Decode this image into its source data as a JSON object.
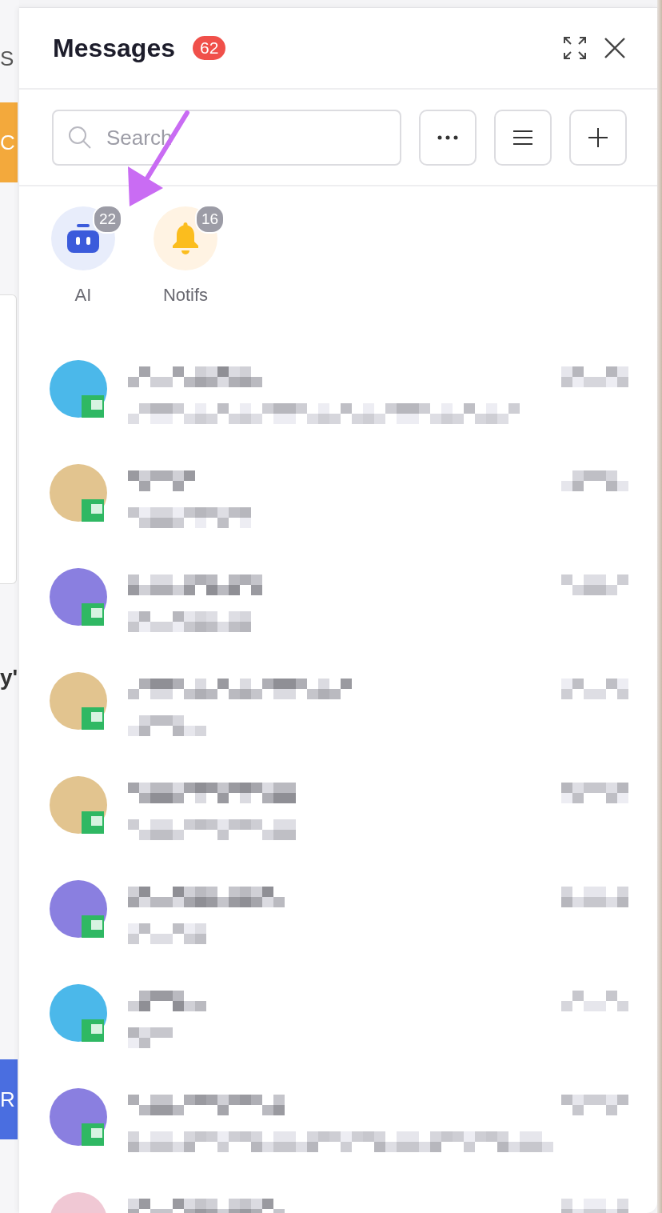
{
  "background_app": {
    "items": [
      {
        "kind": "text",
        "text": "S"
      },
      {
        "kind": "button",
        "text": "C",
        "color": "#f3a93c"
      },
      {
        "kind": "card"
      },
      {
        "kind": "heading",
        "text": "y'"
      },
      {
        "kind": "button",
        "text": "R",
        "color": "#4a6ee0"
      }
    ]
  },
  "panel": {
    "title": "Messages",
    "unread_count": "62",
    "search": {
      "placeholder": "Search"
    },
    "toolbar_buttons": [
      {
        "kind": "more"
      },
      {
        "kind": "filter"
      },
      {
        "kind": "add"
      }
    ],
    "shortcuts": [
      {
        "kind": "ai",
        "label": "AI",
        "count": "22"
      },
      {
        "kind": "notifications",
        "label": "Notifs",
        "count": "16"
      }
    ],
    "conversations": [
      {
        "color": "#4bb8ea"
      },
      {
        "color": "#e2c48f"
      },
      {
        "color": "#8a7fe0"
      },
      {
        "color": "#e2c48f"
      },
      {
        "color": "#e2c48f"
      },
      {
        "color": "#8a7fe0"
      },
      {
        "color": "#4bb8ea"
      },
      {
        "color": "#8a7fe0"
      },
      {
        "color": "#f0c8d4"
      }
    ],
    "annotation": {
      "kind": "arrow"
    }
  }
}
